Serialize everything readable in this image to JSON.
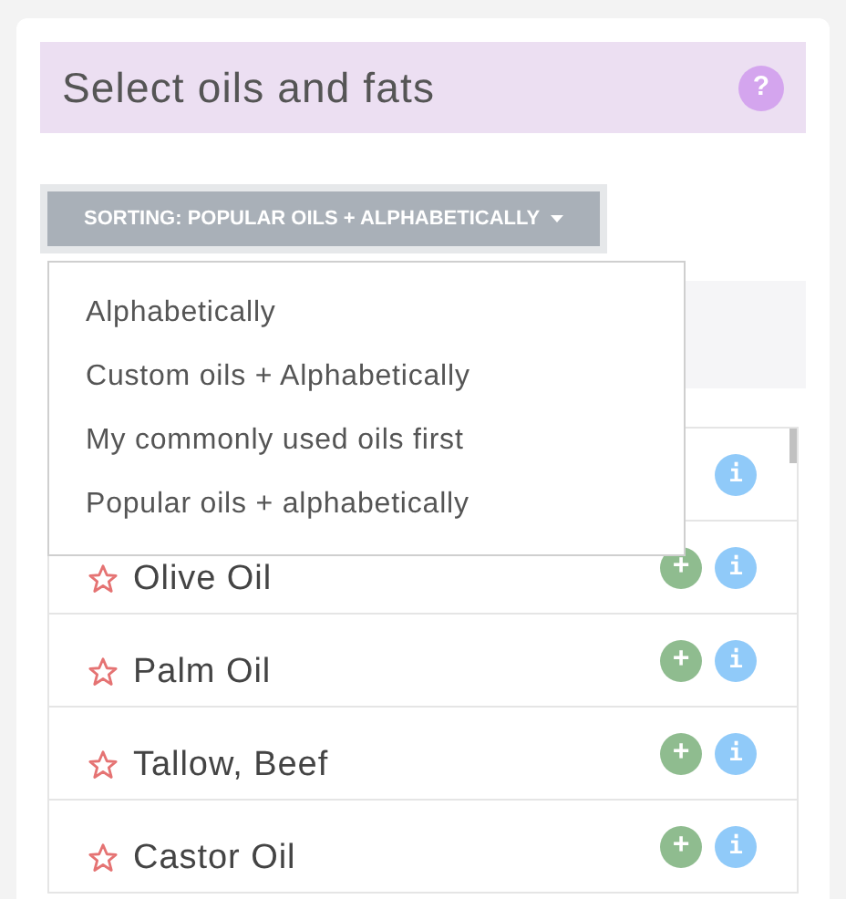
{
  "title": "Select oils and fats",
  "help": "?",
  "sort_button": {
    "label": "SORTING: POPULAR OILS + ALPHABETICALLY",
    "expanded": true
  },
  "sort_menu": [
    {
      "label": "Alphabetically"
    },
    {
      "label": "Custom oils + Alphabetically"
    },
    {
      "label": "My commonly used oils first"
    },
    {
      "label": "Popular oils + alphabetically"
    }
  ],
  "oils": [
    {
      "kind": "hidden",
      "info": "i"
    },
    {
      "kind": "oil",
      "name": "Olive Oil",
      "add": "+",
      "info": "i"
    },
    {
      "kind": "oil",
      "name": "Palm Oil",
      "add": "+",
      "info": "i"
    },
    {
      "kind": "oil",
      "name": "Tallow, Beef",
      "add": "+",
      "info": "i"
    },
    {
      "kind": "oil",
      "name": "Castor Oil",
      "add": "+",
      "info": "i"
    }
  ]
}
